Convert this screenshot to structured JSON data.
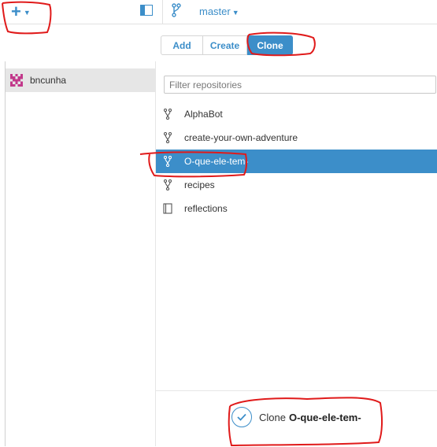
{
  "colors": {
    "accent": "#3c8ec9",
    "selected_bg": "#3c8ec9",
    "avatar": "#c2398b",
    "annotation": "#e01a1a"
  },
  "toolbar": {
    "add_icon": "plus-icon",
    "caret_icon": "caret-down-icon",
    "sidebar_toggle_icon": "sidebar-toggle-icon",
    "branch_icon": "branch-icon",
    "branch": "master"
  },
  "sidebar": {
    "accounts": [
      {
        "name": "bncunha",
        "avatar_icon": "identicon-avatar"
      }
    ]
  },
  "actions": {
    "tabs": [
      {
        "label": "Add",
        "active": false
      },
      {
        "label": "Create",
        "active": false
      },
      {
        "label": "Clone",
        "active": true
      }
    ]
  },
  "filter": {
    "placeholder": "Filter repositories",
    "value": ""
  },
  "repos": [
    {
      "name": "AlphaBot",
      "icon": "fork-icon",
      "selected": false
    },
    {
      "name": "create-your-own-adventure",
      "icon": "fork-icon",
      "selected": false
    },
    {
      "name": "O-que-ele-tem-",
      "icon": "fork-icon",
      "selected": true
    },
    {
      "name": "recipes",
      "icon": "fork-icon",
      "selected": false
    },
    {
      "name": "reflections",
      "icon": "book-icon",
      "selected": false
    }
  ],
  "clone_action": {
    "label": "Clone",
    "repo": "O-que-ele-tem-",
    "icon": "check-icon"
  }
}
